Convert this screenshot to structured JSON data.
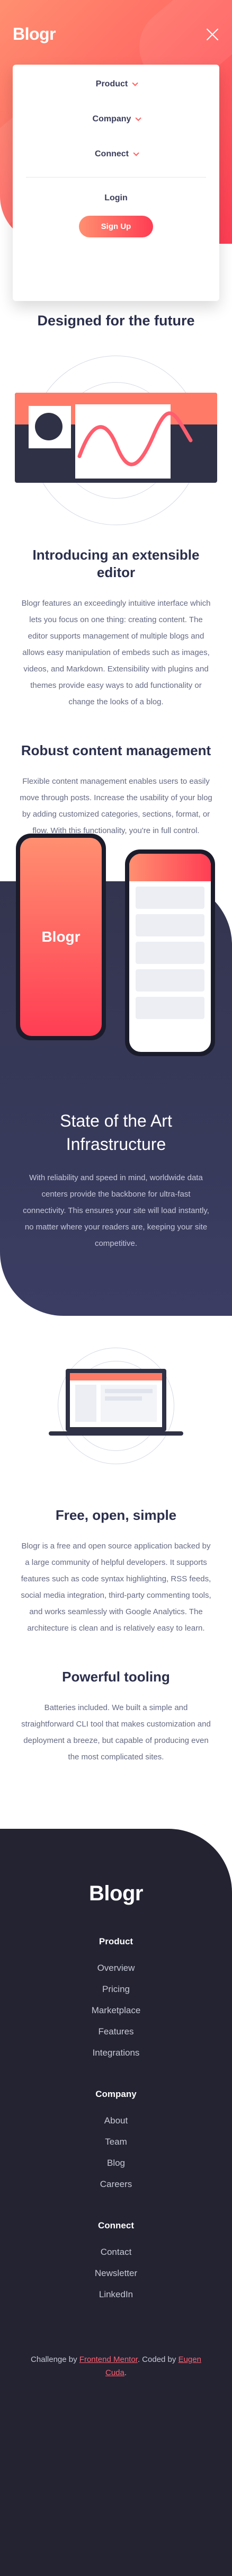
{
  "brand": {
    "logo": "Blogr",
    "accent": "#ff5e5e"
  },
  "nav": {
    "items": [
      {
        "label": "Product"
      },
      {
        "label": "Company"
      },
      {
        "label": "Connect"
      }
    ],
    "login": "Login",
    "signup": "Sign Up"
  },
  "future": {
    "title": "Designed for the future",
    "features": [
      {
        "title": "Introducing an extensible editor",
        "body": "Blogr features an exceedingly intuitive interface which lets you focus on one thing: creating content. The editor supports management of multiple blogs and allows easy manipulation of embeds such as images, videos, and Markdown. Extensibility with plugins and themes provide easy ways to add functionality or change the looks of a blog."
      },
      {
        "title": "Robust content management",
        "body": "Flexible content management enables users to easily move through posts. Increase the usability of your blog by adding customized categories, sections, format, or flow. With this functionality, you're in full control."
      }
    ]
  },
  "state": {
    "phone_logo": "Blogr",
    "title": "State of the Art Infrastructure",
    "body": "With reliability and speed in mind, worldwide data centers provide the backbone for ultra-fast connectivity. This ensures your site will load instantly, no matter where your readers are, keeping your site competitive."
  },
  "tooling": {
    "features": [
      {
        "title": "Free, open, simple",
        "body": "Blogr is a free and open source application backed by a large community of helpful developers. It supports features such as code syntax highlighting, RSS feeds, social media integration, third-party commenting tools, and works seamlessly with Google Analytics. The architecture is clean and is relatively easy to learn."
      },
      {
        "title": "Powerful tooling",
        "body": "Batteries included. We built a simple and straightforward CLI tool that makes customization and deployment a breeze, but capable of producing even the most complicated sites."
      }
    ]
  },
  "footer": {
    "logo": "Blogr",
    "columns": [
      {
        "heading": "Product",
        "links": [
          "Overview",
          "Pricing",
          "Marketplace",
          "Features",
          "Integrations"
        ]
      },
      {
        "heading": "Company",
        "links": [
          "About",
          "Team",
          "Blog",
          "Careers"
        ]
      },
      {
        "heading": "Connect",
        "links": [
          "Contact",
          "Newsletter",
          "LinkedIn"
        ]
      }
    ],
    "attribution": {
      "prefix": "Challenge by",
      "link1": "Frontend Mentor",
      "middle": ". Coded by",
      "link2": "Eugen Cuda",
      "suffix": "."
    }
  }
}
